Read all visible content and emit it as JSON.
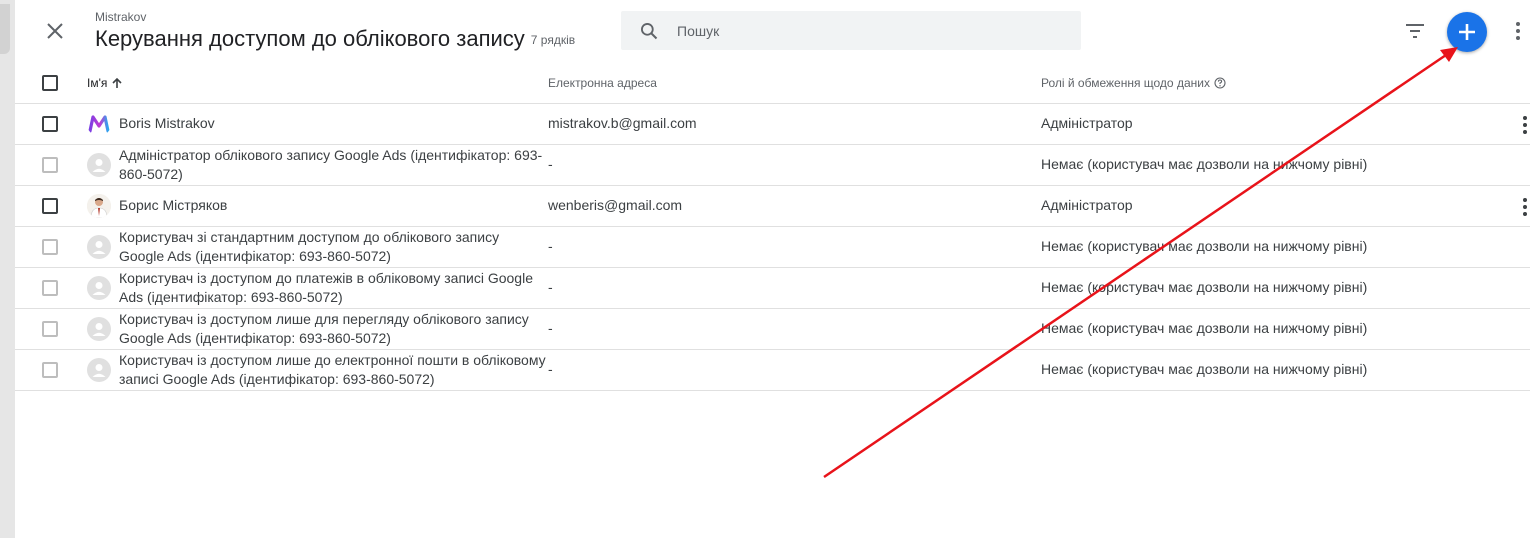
{
  "header": {
    "account_name": "Mistrakov",
    "title": "Керування доступом до облікового запису",
    "row_count": "7 рядків"
  },
  "search": {
    "placeholder": "Пошук",
    "value": ""
  },
  "icons": {
    "close": "close-icon",
    "search": "search-icon",
    "filter": "filter-icon",
    "add": "plus-icon",
    "more": "more-vert-icon",
    "sort": "arrow-up-icon",
    "help": "help-outline-icon"
  },
  "colors": {
    "accent": "#1a73e8",
    "annotation_arrow": "#e8131a"
  },
  "table": {
    "columns": {
      "name": "Ім'я",
      "email": "Електронна адреса",
      "roles": "Ролі й обмеження щодо даних"
    },
    "rows": [
      {
        "name": "Boris Mistrakov",
        "email": "mistrakov.b@gmail.com",
        "role": "Адміністратор"
      },
      {
        "name": "Адміністратор облікового запису Google Ads (ідентифікатор: 693-860-5072)",
        "email": "-",
        "role": "Немає (користувач має дозволи на нижчому рівні)"
      },
      {
        "name": "Борис Містряков",
        "email": "wenberis@gmail.com",
        "role": "Адміністратор"
      },
      {
        "name": "Користувач зі стандартним доступом до облікового запису Google Ads (ідентифікатор: 693-860-5072)",
        "email": "-",
        "role": "Немає (користувач має дозволи на нижчому рівні)"
      },
      {
        "name": "Користувач із доступом до платежів в обліковому записі Google Ads (ідентифікатор: 693-860-5072)",
        "email": "-",
        "role": "Немає (користувач має дозволи на нижчому рівні)"
      },
      {
        "name": "Користувач із доступом лише для перегляду облікового запису Google Ads (ідентифікатор: 693-860-5072)",
        "email": "-",
        "role": "Немає (користувач має дозволи на нижчому рівні)"
      },
      {
        "name": "Користувач із доступом лише до електронної пошти в обліковому записі Google Ads (ідентифікатор: 693-860-5072)",
        "email": "-",
        "role": "Немає (користувач має дозволи на нижчому рівні)"
      }
    ]
  }
}
